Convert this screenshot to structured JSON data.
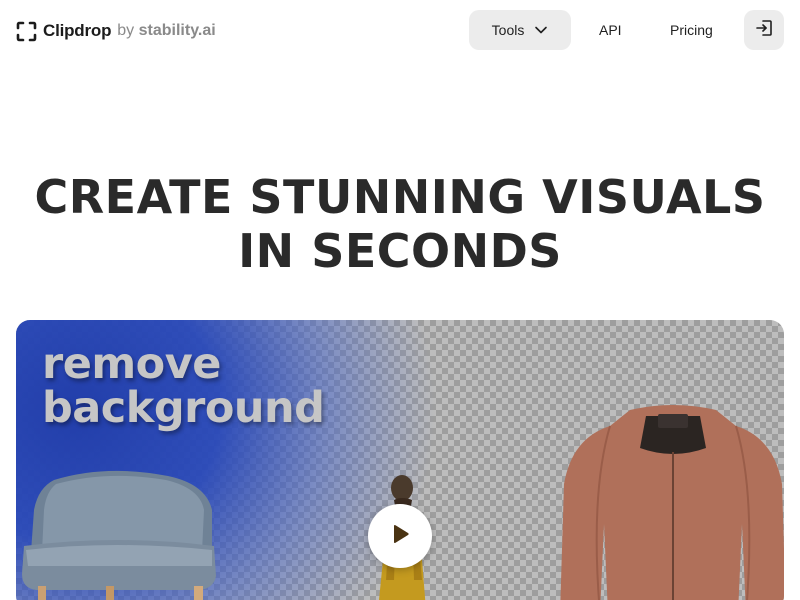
{
  "header": {
    "logo_text": "Clipdrop",
    "by_prefix": "by",
    "by_brand": "stability.ai",
    "nav": {
      "tools_label": "Tools",
      "api_label": "API",
      "pricing_label": "Pricing"
    },
    "icons": {
      "logo": "clipdrop-logo-icon",
      "tools_chevron": "chevron-down-icon",
      "login": "login-icon"
    }
  },
  "hero": {
    "title_line1": "CREATE STUNNING VISUALS",
    "title_line2": "IN SECONDS"
  },
  "video": {
    "caption_line1": "remove",
    "caption_line2": "background",
    "play_icon": "play-icon"
  },
  "colors": {
    "accent_blue": "#2a46b4",
    "play_arrow": "#4a3312",
    "button_bg": "#ececec"
  }
}
